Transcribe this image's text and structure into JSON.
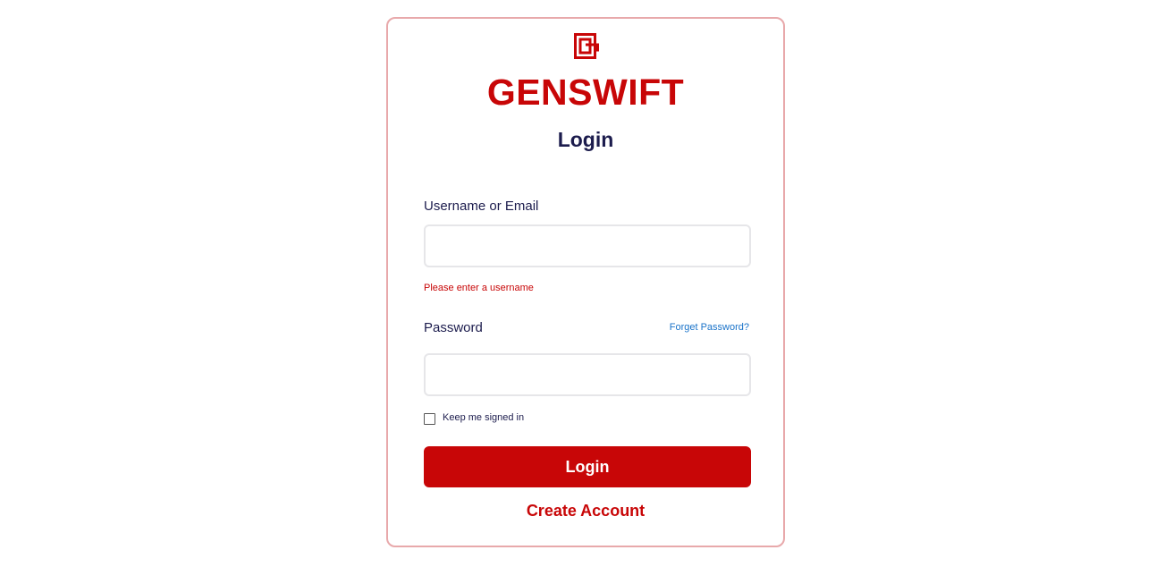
{
  "brand": {
    "name": "GENSWIFT",
    "logo_icon": "genswift-logo-icon",
    "color": "#c80607"
  },
  "form": {
    "title": "Login",
    "username_label": "Username or Email",
    "username_value": "",
    "username_placeholder": "",
    "username_error": "Please enter a username",
    "password_label": "Password",
    "password_value": "",
    "password_placeholder": "",
    "forgot_link": "Forget Password?",
    "keep_signed_in_label": "Keep me signed in",
    "keep_signed_in_checked": false,
    "login_button": "Login",
    "create_account": "Create Account"
  },
  "colors": {
    "accent": "#c80607",
    "heading": "#1c1c4d",
    "link": "#1a73c9",
    "card_border": "#e8a9ab"
  }
}
